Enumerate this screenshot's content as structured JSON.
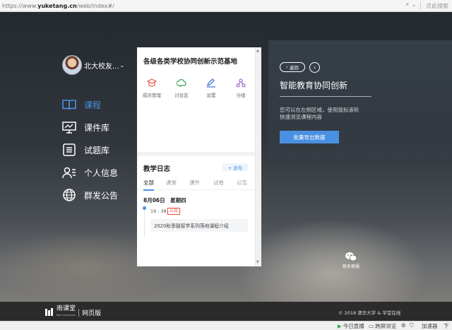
{
  "browser": {
    "url_prefix": "https://www.",
    "url_domain": "yuketang.cn",
    "url_path": "/web/index#/",
    "search_placeholder": "点此搜索"
  },
  "user": {
    "name": "北大校友...",
    "chevron": "⌄"
  },
  "nav": {
    "items": [
      {
        "label": "课程",
        "icon": "book-icon",
        "active": true
      },
      {
        "label": "课件库",
        "icon": "presentation-icon",
        "active": false
      },
      {
        "label": "试题库",
        "icon": "list-icon",
        "active": false
      },
      {
        "label": "个人信息",
        "icon": "user-card-icon",
        "active": false
      },
      {
        "label": "群发公告",
        "icon": "globe-icon",
        "active": false
      }
    ]
  },
  "panel": {
    "title": "各级各类学校协同创新示范基地",
    "tools": [
      {
        "label": "成员管理",
        "icon": "graduation-cap-icon",
        "color": "#e8533c"
      },
      {
        "label": "讨论区",
        "icon": "chat-cloud-icon",
        "color": "#3aa34a"
      },
      {
        "label": "设置",
        "icon": "edit-icon",
        "color": "#3b6fd6"
      },
      {
        "label": "分组",
        "icon": "group-icon",
        "color": "#8e4fc8"
      }
    ],
    "journal_title": "教学日志",
    "publish_label": "+ 发布",
    "tabs": [
      "全部",
      "课堂",
      "课件",
      "试卷",
      "公告"
    ],
    "active_tab": 0,
    "log": {
      "date": "8月06日　星期四",
      "time": "19 : 38",
      "badge": "公告",
      "entry": "2020秋季融智学系列落地课程介绍"
    }
  },
  "right": {
    "back_label": "返回",
    "next_label": "›",
    "title": "智能教育协同创新",
    "desc_line1": "您可以在左侧区域，使用鼠标滚轮",
    "desc_line2": "快速浏览课程内容",
    "export_label": "批量导出数据",
    "service_label": "联系客服"
  },
  "footer": {
    "logo_name": "雨课堂",
    "logo_sub": "Rain Classroom",
    "web_label": "网页版",
    "copyright": "© 2018 清华大学 & 学堂在线"
  },
  "statusbar": {
    "live": "今日直播",
    "cross": "跨屏浏览",
    "accel": "加速器",
    "download": "下"
  },
  "colors": {
    "accent": "#4a90e2",
    "badge_red": "#e8533c",
    "footer_bg": "#2b2b2b"
  }
}
